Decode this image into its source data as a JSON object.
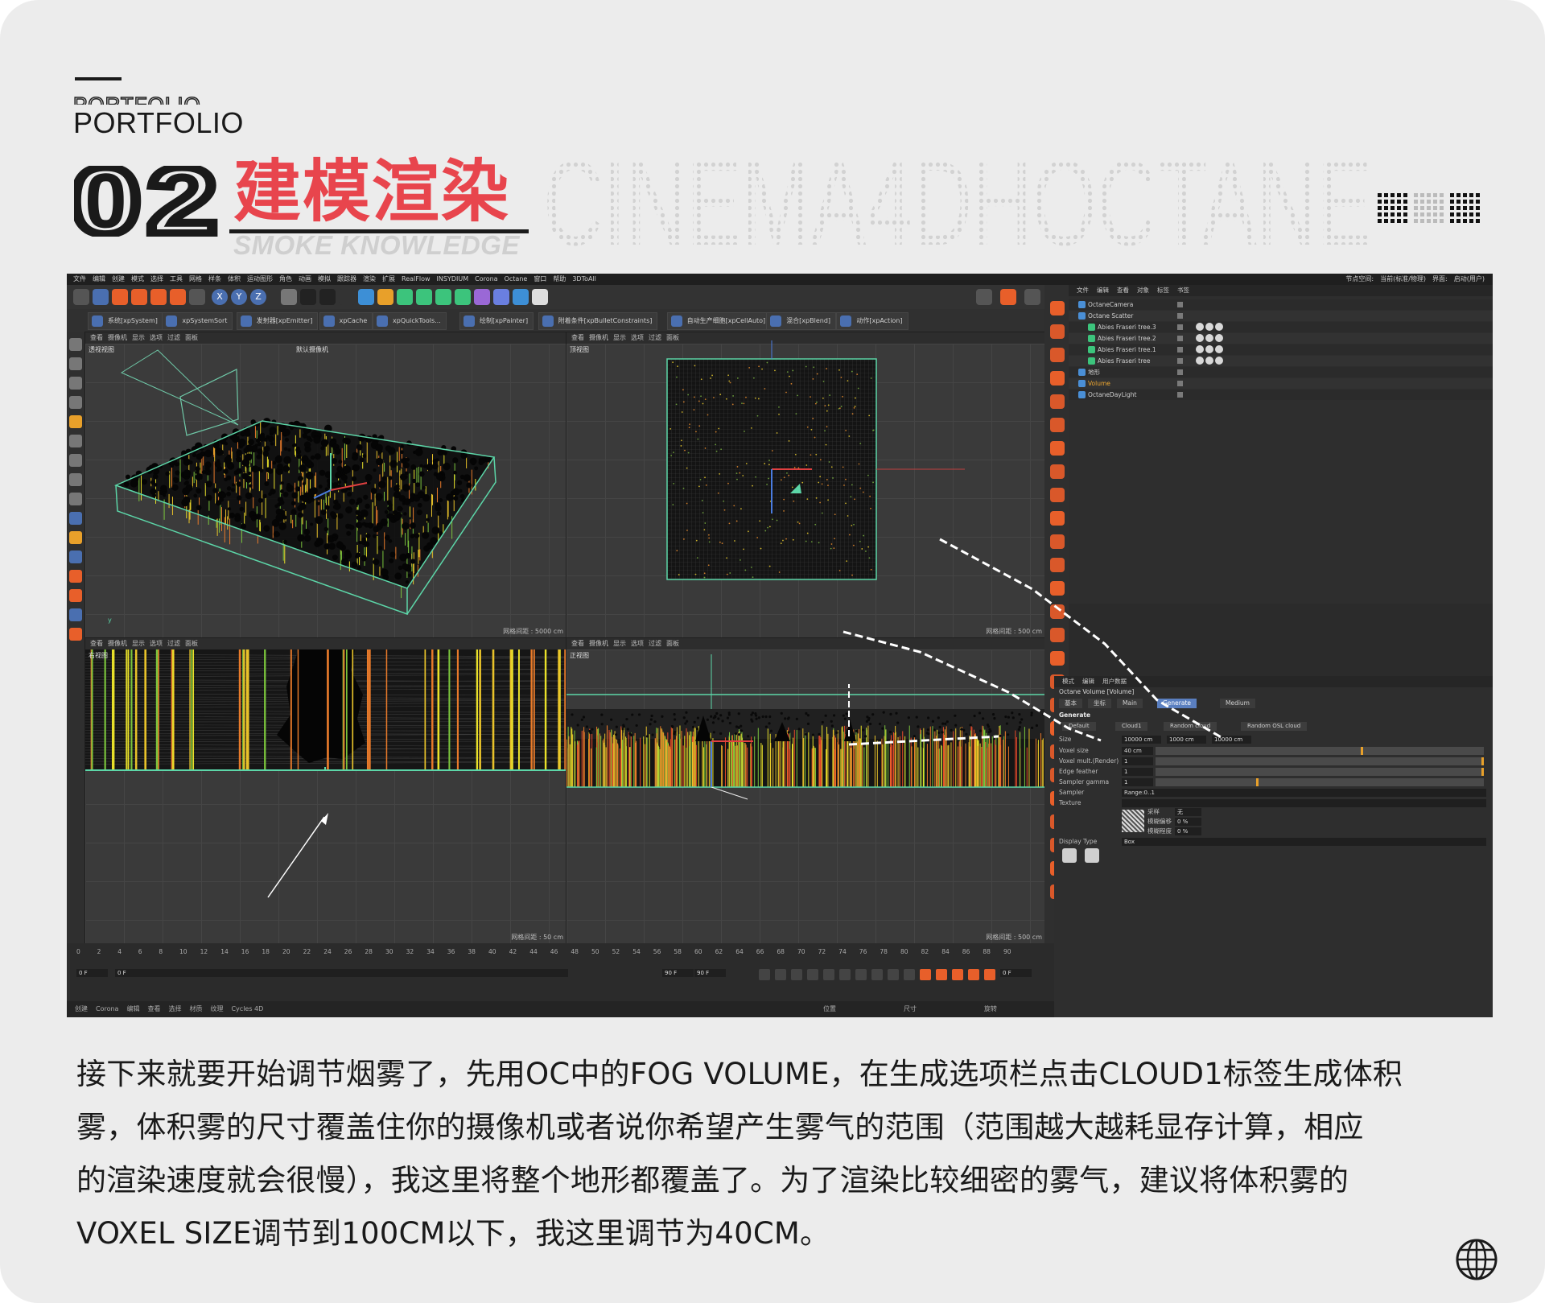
{
  "header": {
    "kicker": "PORTFOLIO",
    "section_number": "02",
    "section_title": "建模渲染",
    "section_subtitle": "SMOKE KNOWLEDGE",
    "ghost_title": "CINEMA4DHOCTANE"
  },
  "c4d": {
    "menu": [
      "文件",
      "编辑",
      "创建",
      "模式",
      "选择",
      "工具",
      "网格",
      "样条",
      "体积",
      "运动图形",
      "角色",
      "动画",
      "模拟",
      "跟踪器",
      "渲染",
      "扩展",
      "RealFlow",
      "INSYDIUM",
      "Corona",
      "Octane",
      "窗口",
      "帮助",
      "3DToAll"
    ],
    "menu_right": [
      "节点空间:",
      "当前(标准/物理)",
      "界面:",
      "启动(用户)"
    ],
    "axis_buttons": [
      "X",
      "Y",
      "Z"
    ],
    "plugins": [
      "系统[xpSystem]",
      "xpSystemSort",
      "发射器[xpEmitter]",
      "xpCache",
      "xpQuickTools...",
      "绘制[xpPainter]",
      "附着条件[xpBulletConstraints]",
      "自动生产细胞[xpCellAuto]",
      "混合[xpBlend]",
      "动作[xpAction]"
    ],
    "viewport_menu": [
      "查看",
      "摄像机",
      "显示",
      "选项",
      "过滤",
      "面板"
    ],
    "viewports": [
      {
        "label": "透视视图",
        "camera": "默认摄像机",
        "footer": "网格间距 : 5000 cm"
      },
      {
        "label": "顶视图",
        "camera": "",
        "footer": "网格间距 : 500 cm"
      },
      {
        "label": "右视图",
        "camera": "",
        "footer": "网格间距 : 50 cm"
      },
      {
        "label": "正视图",
        "camera": "",
        "footer": "网格间距 : 500 cm"
      }
    ],
    "object_menu": [
      "文件",
      "编辑",
      "查看",
      "对象",
      "标签",
      "书签"
    ],
    "objects": [
      {
        "name": "OctaneCamera",
        "indent": 0,
        "highlight": false
      },
      {
        "name": "Octane Scatter",
        "indent": 0,
        "highlight": false
      },
      {
        "name": "Abies Fraseri tree.3",
        "indent": 1,
        "highlight": false
      },
      {
        "name": "Abies Fraseri tree.2",
        "indent": 1,
        "highlight": false
      },
      {
        "name": "Abies Fraseri tree.1",
        "indent": 1,
        "highlight": false
      },
      {
        "name": "Abies Fraseri tree",
        "indent": 1,
        "highlight": false
      },
      {
        "name": "地形",
        "indent": 0,
        "highlight": false
      },
      {
        "name": "Volume",
        "indent": 0,
        "highlight": true
      },
      {
        "name": "OctaneDayLight",
        "indent": 0,
        "highlight": false
      }
    ],
    "attr_menu": [
      "模式",
      "编辑",
      "用户数据"
    ],
    "attr_object": "Octane Volume [Volume]",
    "attr_tabs": [
      "基本",
      "坐标",
      "Main",
      "Generate",
      "Medium"
    ],
    "attr_active_tab": "Generate",
    "generate_label": "Generate",
    "gen_buttons": [
      "Default",
      "Cloud1",
      "Random cloud",
      "Random OSL cloud"
    ],
    "size_label": "Size",
    "size_values": [
      "10000 cm",
      "1000 cm",
      "10000 cm"
    ],
    "params": [
      {
        "label": "Voxel size",
        "value": "40 cm"
      },
      {
        "label": "Voxel mult.(Render)",
        "value": "1"
      },
      {
        "label": "Edge feather",
        "value": "1"
      },
      {
        "label": "Sampler gamma",
        "value": "1"
      },
      {
        "label": "Sampler",
        "value": "Range:0..1"
      },
      {
        "label": "Texture",
        "value": ""
      }
    ],
    "texture_rows": [
      "采样",
      "模糊偏移",
      "模糊程度"
    ],
    "texture_vals": [
      "无",
      "0 %",
      "0 %"
    ],
    "display_type_label": "Display Type",
    "display_type": "Box",
    "timeline_marks": [
      "0",
      "2",
      "4",
      "6",
      "8",
      "10",
      "12",
      "14",
      "16",
      "18",
      "20",
      "22",
      "24",
      "26",
      "28",
      "30",
      "32",
      "34",
      "36",
      "38",
      "40",
      "42",
      "44",
      "46",
      "48",
      "50",
      "52",
      "54",
      "56",
      "58",
      "60",
      "62",
      "64",
      "66",
      "68",
      "70",
      "72",
      "74",
      "76",
      "78",
      "80",
      "82",
      "84",
      "86",
      "88",
      "90"
    ],
    "frame_fields": [
      "0 F",
      "0 F",
      "90 F",
      "90 F",
      "0 F"
    ],
    "status_left": [
      "创建",
      "Corona",
      "编辑",
      "查看",
      "选择",
      "材质",
      "纹理",
      "Cycles 4D"
    ],
    "status_right": [
      "位置",
      "尺寸",
      "旋转"
    ]
  },
  "paragraph": [
    "接下来就要开始调节烟雾了，先用OC中的FOG VOLUME，在生成选项栏点击CLOUD1标签生成体积",
    "雾，体积雾的尺寸覆盖住你的摄像机或者说你希望产生雾气的范围（范围越大越耗显存计算，相应",
    "的渲染速度就会很慢），我这里将整个地形都覆盖了。为了渲染比较细密的雾气，建议将体积雾的",
    "VOXEL SIZE调节到100CM以下，我这里调节为40CM。"
  ],
  "colors": {
    "accent": "#e8454d",
    "background": "#ececec",
    "ui_dark": "#2b2b2b",
    "icon_orange": "#e85f2a",
    "bbox_green": "#5cd6a8"
  }
}
